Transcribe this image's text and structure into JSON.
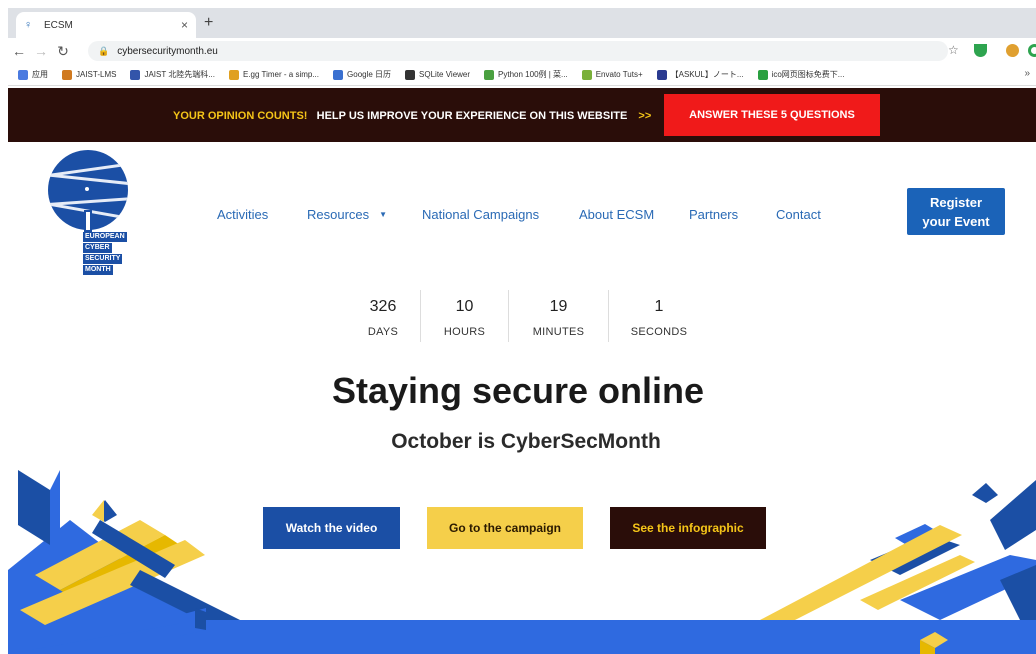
{
  "browser": {
    "tab_title": "ECSM",
    "tab_close": "×",
    "new_tab": "+",
    "url": "cybersecuritymonth.eu",
    "bookmarks": [
      {
        "label": "应用",
        "color": "#4a7ae0"
      },
      {
        "label": "JAIST-LMS",
        "color": "#d07a20"
      },
      {
        "label": "JAIST 北陸先端科...",
        "color": "#3355aa"
      },
      {
        "label": "E.gg Timer - a simp...",
        "color": "#e0a020"
      },
      {
        "label": "Google 日历",
        "color": "#3a70d0"
      },
      {
        "label": "SQLite Viewer",
        "color": "#333333"
      },
      {
        "label": "Python 100例 | 菜...",
        "color": "#4aa040"
      },
      {
        "label": "Envato Tuts+",
        "color": "#7ab03a"
      },
      {
        "label": "【ASKUL】ノート...",
        "color": "#2a3a90"
      },
      {
        "label": "ico网页图标免费下...",
        "color": "#2aa040"
      }
    ],
    "more": "»"
  },
  "banner": {
    "prefix": "YOUR OPINION COUNTS!",
    "text": "HELP US IMPROVE YOUR EXPERIENCE ON THIS WEBSITE",
    "arrows": ">>",
    "button": "ANSWER THESE 5 QUESTIONS"
  },
  "logo": {
    "lines": [
      "EUROPEAN",
      "CYBER",
      "SECURITY",
      "MONTH"
    ]
  },
  "nav": {
    "activities": "Activities",
    "resources": "Resources",
    "national_campaigns": "National Campaigns",
    "about": "About ECSM",
    "partners": "Partners",
    "contact": "Contact",
    "register_line1": "Register",
    "register_line2": "your Event"
  },
  "countdown": [
    {
      "value": "326",
      "label": "DAYS"
    },
    {
      "value": "10",
      "label": "HOURS"
    },
    {
      "value": "19",
      "label": "MINUTES"
    },
    {
      "value": "1",
      "label": "SECONDS"
    }
  ],
  "hero": {
    "title": "Staying secure online",
    "subtitle": "October is CyberSecMonth"
  },
  "cta": {
    "video": "Watch the video",
    "campaign": "Go to the campaign",
    "infographic": "See the infographic"
  },
  "colors": {
    "brand_blue": "#1b4fa5",
    "brand_yellow": "#f5cf4a",
    "dark_maroon": "#2a0d09",
    "alert_red": "#f01a1a",
    "link_blue": "#2a6ab5"
  }
}
